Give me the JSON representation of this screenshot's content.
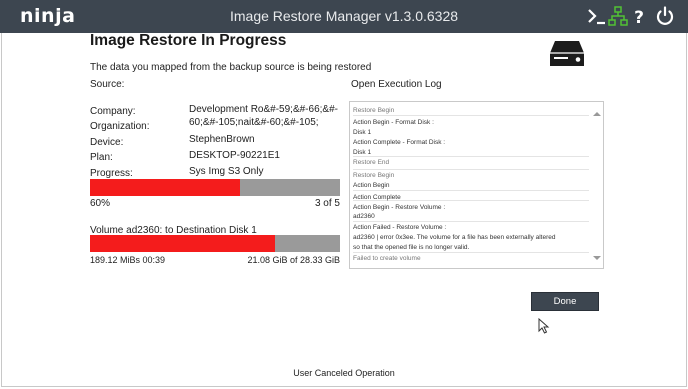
{
  "app": {
    "logo": "ninja",
    "title": "Image Restore Manager v1.3.0.6328"
  },
  "header": {
    "title": "Image Restore In Progress",
    "subtitle": "The data you mapped from the backup source is being restored"
  },
  "source": {
    "label": "Source:",
    "fields": [
      {
        "label": "Company:",
        "value": "Development Ro&#-59;&#-66;&#-"
      },
      {
        "label": "Organization:",
        "value": "60;&#-105;nait&#-60;&#-105;"
      },
      {
        "label": "Device:",
        "value": "StephenBrown"
      },
      {
        "label": "Plan:",
        "value": "DESKTOP-90221E1"
      },
      {
        "label": "Progress:",
        "value": "Sys Img S3 Only"
      }
    ]
  },
  "progress": {
    "fraction": 0.6,
    "percent_label": "60%",
    "count_label": "3 of 5"
  },
  "volume": {
    "label": "Volume ad2360:  to Destination Disk 1",
    "fraction": 0.74,
    "speed_label": "189.12 MiBs  00:39",
    "size_label": "21.08 GiB of 28.33 GiB"
  },
  "log": {
    "title": "Open Execution Log",
    "lines": [
      {
        "text": "Restore Begin",
        "grey": true
      },
      {
        "text": "Action Begin - Format Disk :",
        "grey": false
      },
      {
        "text": "    Disk 1",
        "grey": false
      },
      {
        "text": "Action Complete - Format Disk :",
        "grey": false
      },
      {
        "text": "    Disk 1",
        "grey": false
      },
      {
        "text": "Restore End",
        "grey": true
      },
      {
        "text": "Restore Begin",
        "grey": true
      },
      {
        "text": "Action Begin",
        "grey": false
      },
      {
        "text": "Action Complete",
        "grey": false
      },
      {
        "text": "Action Begin - Restore Volume :",
        "grey": false
      },
      {
        "text": "    ad2360",
        "grey": false
      },
      {
        "text": "Action Failed - Restore Volume :",
        "grey": false
      },
      {
        "text": "    ad2360 | error 0x3ee. The volume for a file has been externally altered",
        "grey": false
      },
      {
        "text": "so that the opened file is no longer valid.",
        "grey": false
      },
      {
        "text": "Failed to create volume",
        "grey": true
      }
    ]
  },
  "buttons": {
    "done": "Done"
  },
  "footer": {
    "status": "User Canceled Operation"
  },
  "icons": [
    "terminal-icon",
    "network-icon",
    "help-icon",
    "power-icon",
    "drive-icon",
    "mouse-cursor-icon"
  ],
  "colors": {
    "titlebar": "#3d4650",
    "progress_fill": "#f41c1c",
    "progress_track": "#9a9a9a",
    "network_icon": "#52c234"
  }
}
